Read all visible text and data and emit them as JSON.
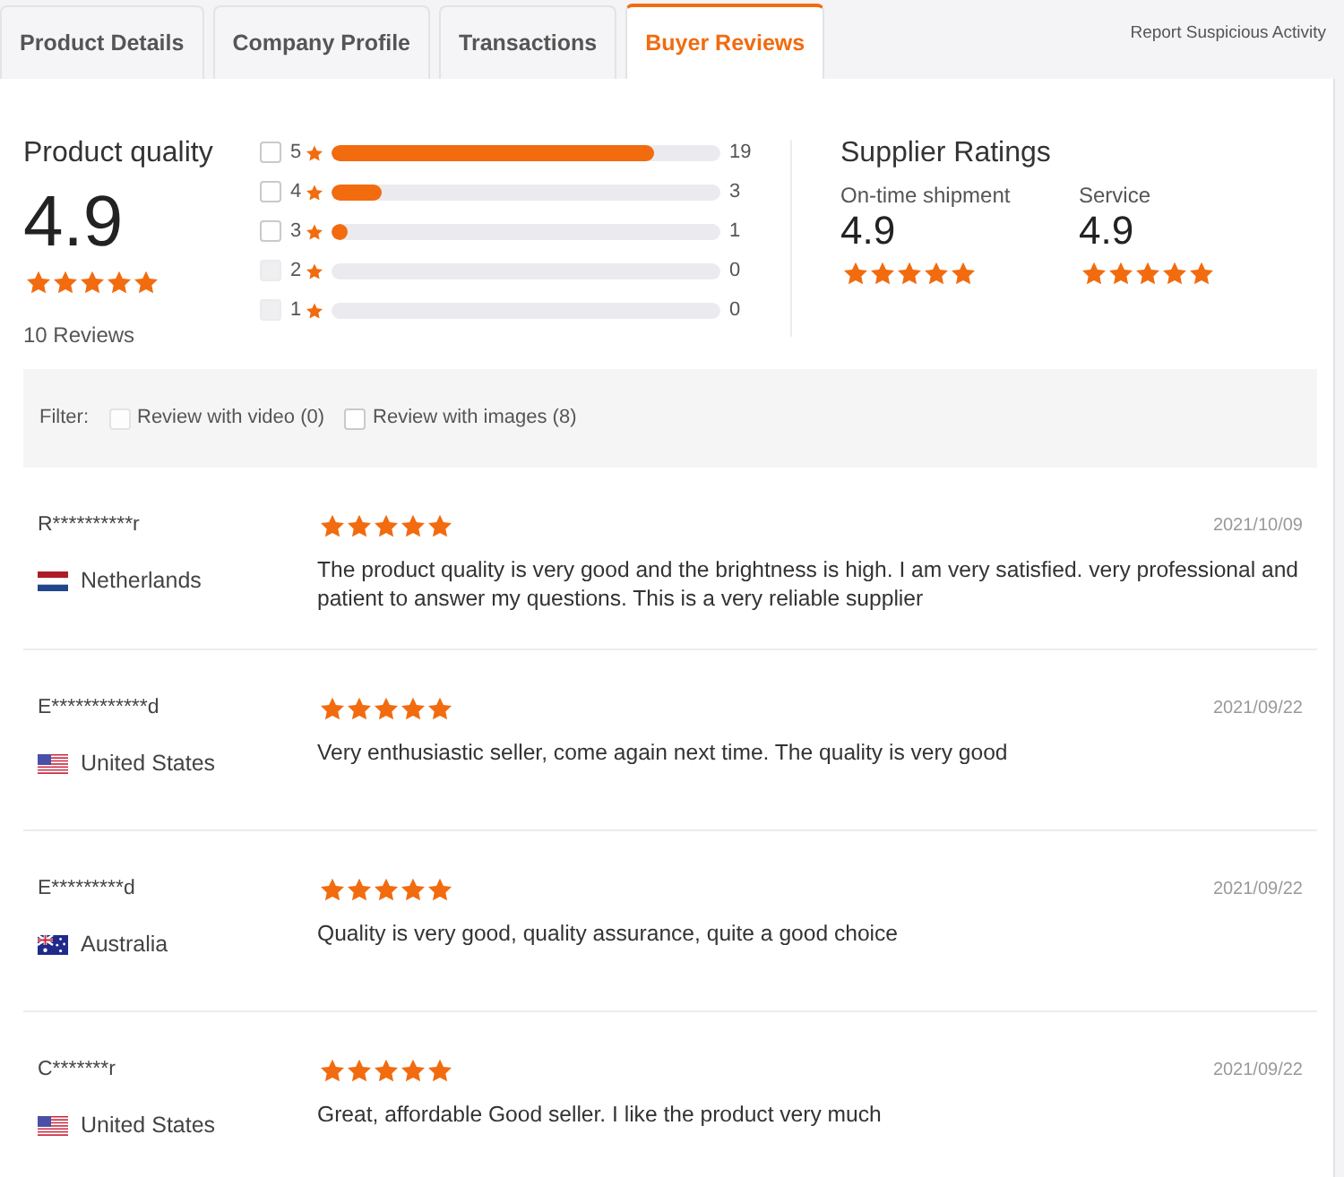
{
  "tabs": [
    {
      "label": "Product Details",
      "selected": false
    },
    {
      "label": "Company Profile",
      "selected": false
    },
    {
      "label": "Transactions",
      "selected": false
    },
    {
      "label": "Buyer Reviews",
      "selected": true
    }
  ],
  "report_link": "Report Suspicious Activity",
  "product_quality": {
    "title": "Product quality",
    "score": "4.9",
    "stars": 5,
    "reviews": "10 Reviews"
  },
  "histogram": [
    {
      "rating": "5",
      "checked": false,
      "disabled": false,
      "level": 0.83,
      "count": "19"
    },
    {
      "rating": "4",
      "checked": false,
      "disabled": false,
      "level": 0.13,
      "count": "3"
    },
    {
      "rating": "3",
      "checked": false,
      "disabled": false,
      "level": 0.04,
      "count": "1"
    },
    {
      "rating": "2",
      "checked": false,
      "disabled": true,
      "count": "0"
    },
    {
      "rating": "1",
      "checked": false,
      "disabled": true,
      "count": "0"
    }
  ],
  "supplier_ratings": {
    "title": "Supplier Ratings",
    "metrics": [
      {
        "label": "On-time shipment",
        "score": "4.9",
        "stars": 5
      },
      {
        "label": "Service",
        "score": "4.9",
        "stars": 5
      }
    ]
  },
  "filter": {
    "label": "Filter:",
    "options": [
      {
        "label": "Review with video (0)",
        "checked": false,
        "disabled": true
      },
      {
        "label": "Review with images (8)",
        "checked": false,
        "disabled": false
      }
    ]
  },
  "reviews": [
    {
      "reviewer": "R**********r",
      "kind": "nl",
      "country": "Netherlands",
      "stars": 5,
      "date": "2021/10/09",
      "text": "The product quality is very good and the brightness is high. I am very satisfied. very professional and patient to answer my questions. This is a very reliable supplier"
    },
    {
      "reviewer": "E************d",
      "kind": "us",
      "country": "United States",
      "stars": 5,
      "date": "2021/09/22",
      "text": "Very enthusiastic seller, come again next time. The quality is very good"
    },
    {
      "reviewer": "E*********d",
      "kind": "au",
      "country": "Australia",
      "stars": 5,
      "date": "2021/09/22",
      "text": "Quality is very good, quality assurance, quite a good choice"
    },
    {
      "reviewer": "C*******r",
      "kind": "us",
      "country": "United States",
      "stars": 5,
      "date": "2021/09/22",
      "text": "Great, affordable Good seller. I like the product very much"
    }
  ]
}
